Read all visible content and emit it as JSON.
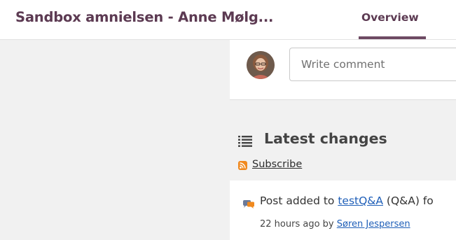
{
  "header": {
    "site_title": "Sandbox amnielsen - Anne Mølg...",
    "tabs": [
      {
        "label": "Overview",
        "active": true
      }
    ]
  },
  "comment_box": {
    "avatar_icon": "user-avatar",
    "placeholder": "Write comment"
  },
  "latest_changes": {
    "icon": "list-icon",
    "title": "Latest changes",
    "subscribe_icon": "rss-icon",
    "subscribe_label": "Subscribe",
    "items": [
      {
        "icon": "chat-bubbles-icon",
        "prefix": "Post added to ",
        "target_link": "testQ&A",
        "suffix": " (Q&A) fo",
        "time": "22 hours ago",
        "by_label": " by ",
        "author": "Søren Jespersen"
      }
    ]
  },
  "colors": {
    "brand": "#5c3a52",
    "link": "#1f5fb8",
    "rss": "#f0891e",
    "background": "#f1f1f1"
  }
}
